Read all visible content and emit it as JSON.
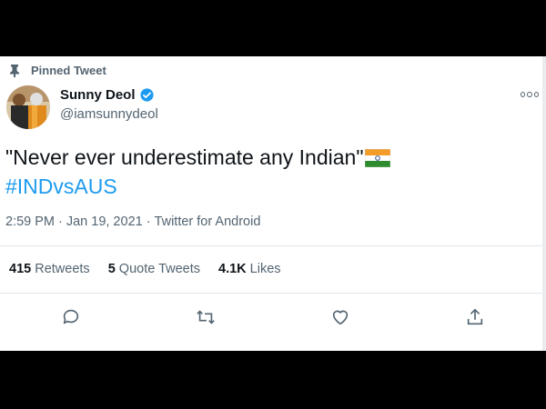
{
  "pinned_label": "Pinned Tweet",
  "author": {
    "name": "Sunny Deol",
    "handle": "@iamsunnydeol",
    "verified": true
  },
  "tweet": {
    "text": "\"Never ever underestimate any Indian\"",
    "emoji": "indian-flag",
    "hashtag": "#INDvsAUS",
    "time": "2:59 PM",
    "date": "Jan 19, 2021",
    "source": "Twitter for Android"
  },
  "stats": {
    "retweets_count": "415",
    "retweets_label": "Retweets",
    "quotes_count": "5",
    "quotes_label": "Quote Tweets",
    "likes_count": "4.1K",
    "likes_label": "Likes"
  },
  "colors": {
    "accent": "#1d9bf0",
    "text": "#0f1419",
    "secondary": "#536471"
  },
  "icons": [
    "pin-icon",
    "verified-badge-icon",
    "more-icon",
    "reply-icon",
    "retweet-icon",
    "like-icon",
    "share-icon"
  ]
}
